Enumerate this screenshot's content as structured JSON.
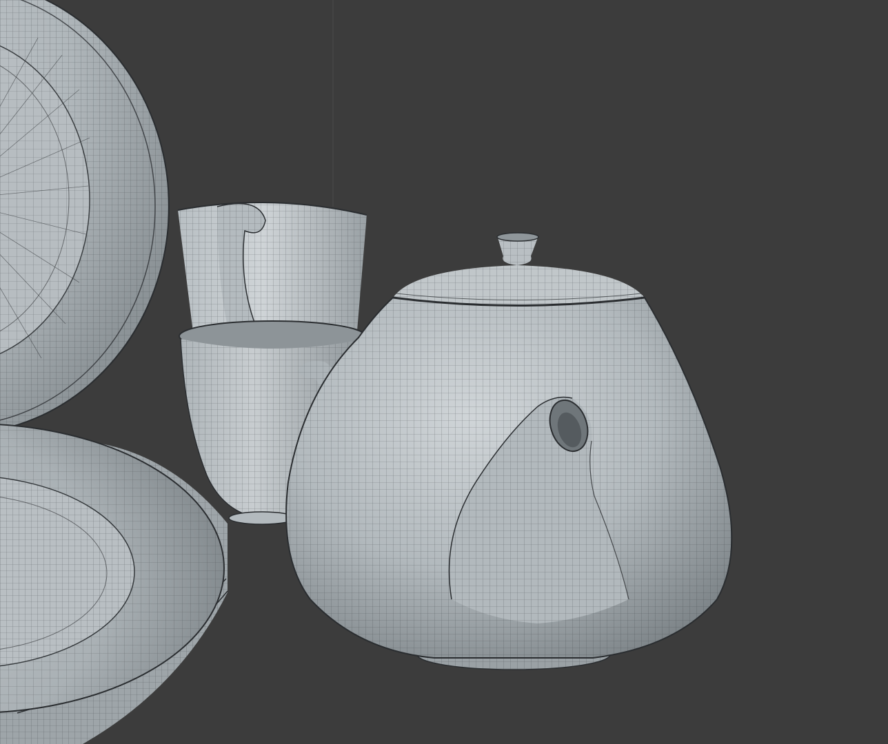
{
  "scene": {
    "background_color": "#3c3c3c",
    "wire_color": "#2e3134",
    "surface_color": "#a9b0b4",
    "surface_highlight": "#c9cfd2",
    "surface_shadow": "#7d8488",
    "objects": [
      {
        "name": "upper-plate",
        "kind": "plate"
      },
      {
        "name": "lower-plate-stack",
        "kind": "plate"
      },
      {
        "name": "back-cup",
        "kind": "cup"
      },
      {
        "name": "front-cup",
        "kind": "cup"
      },
      {
        "name": "teapot",
        "kind": "teapot"
      }
    ]
  }
}
